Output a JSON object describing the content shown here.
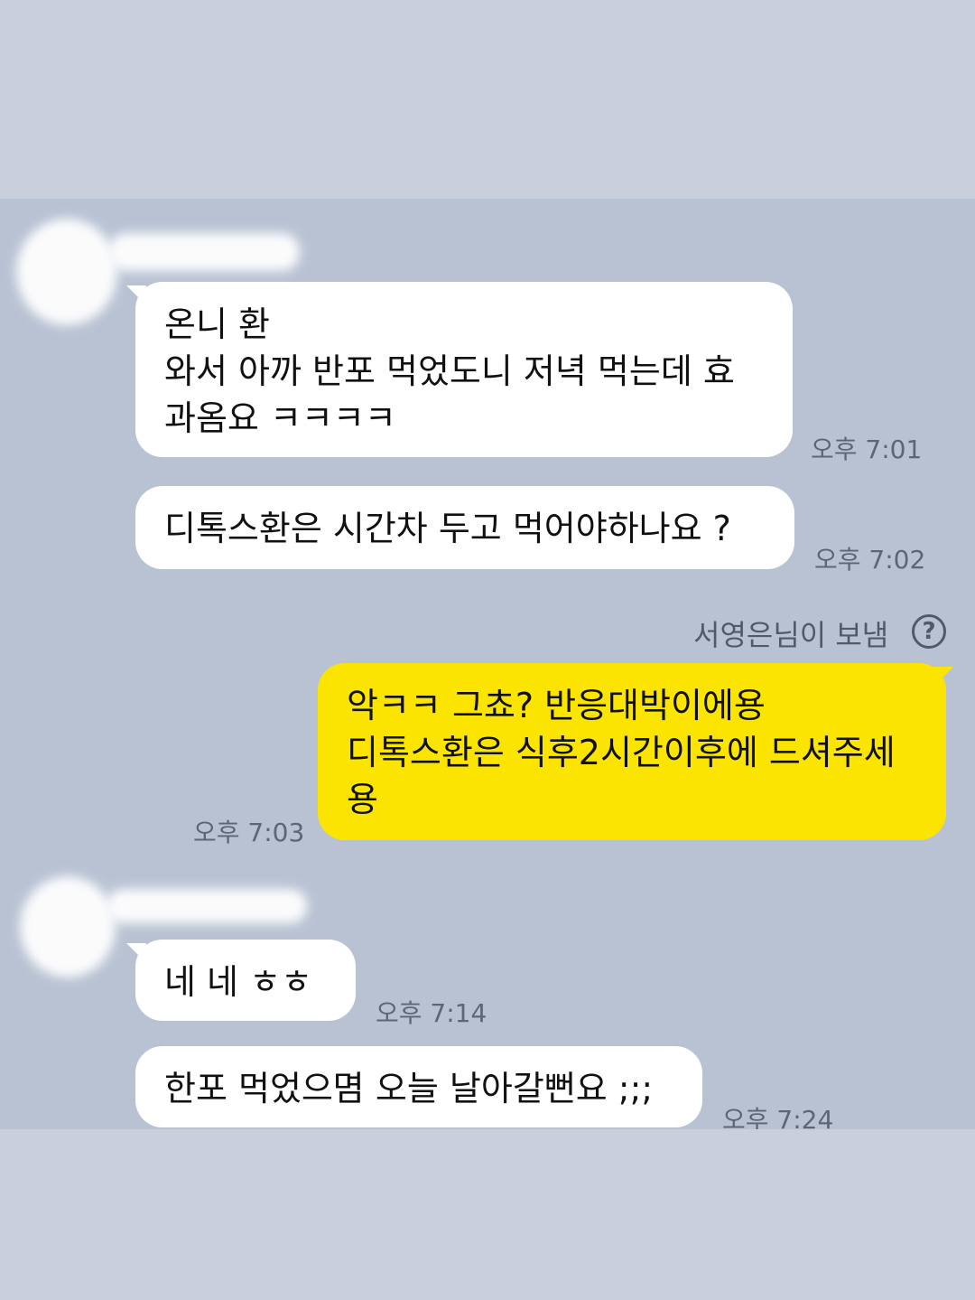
{
  "chat": {
    "messages": [
      {
        "side": "in",
        "lines": [
          "온니 환",
          "와서 아까 반포 먹었도니 저녁 먹는데 효",
          "과옴요 ㅋㅋㅋㅋ"
        ],
        "time": "오후 7:01"
      },
      {
        "side": "in",
        "lines": [
          "디톡스환은 시간차 두고 먹어야하나요 ?"
        ],
        "time": "오후 7:02"
      },
      {
        "side": "out",
        "lines": [
          "악ㅋㅋ 그쵸? 반응대박이에용",
          "디톡스환은 식후2시간이후에 드셔주세",
          "용"
        ],
        "time": "오후 7:03"
      },
      {
        "side": "in",
        "lines": [
          "네 네 ㅎㅎ"
        ],
        "time": "오후 7:14"
      },
      {
        "side": "in",
        "lines": [
          "한포 먹었으몀 오늘 날아갈뻔요 ;;;"
        ],
        "time": "오후 7:24"
      }
    ],
    "sent_notice": "서영은님이 보냄",
    "help_icon_glyph": "?",
    "colors": {
      "chat_background": "#b8c2d3",
      "incoming_bubble": "#ffffff",
      "outgoing_bubble": "#fbe500"
    }
  }
}
